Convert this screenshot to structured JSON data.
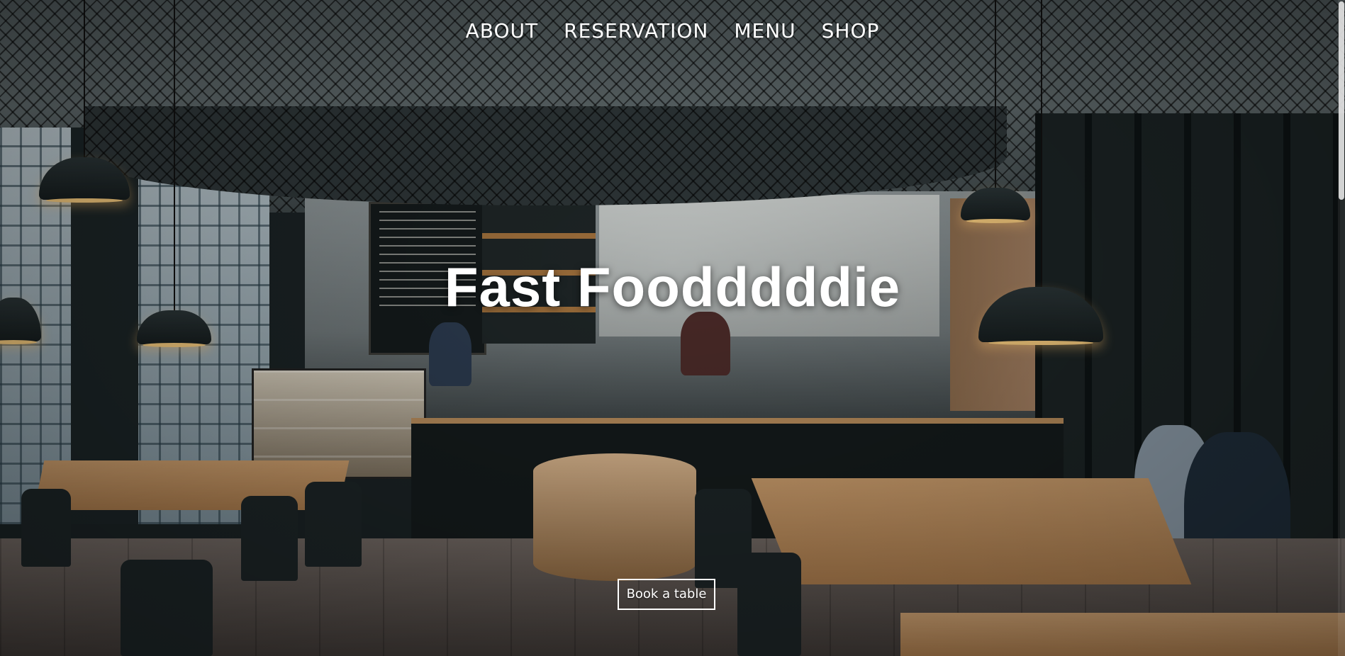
{
  "nav": {
    "items": [
      {
        "label": "ABOUT"
      },
      {
        "label": "RESERVATION"
      },
      {
        "label": "MENU"
      },
      {
        "label": "SHOP"
      }
    ]
  },
  "hero": {
    "title": "Fast Foodddddie",
    "cta_label": "Book a table"
  },
  "colors": {
    "text": "#ffffff",
    "wood": "#b58a5a",
    "dark": "#141a1b"
  }
}
